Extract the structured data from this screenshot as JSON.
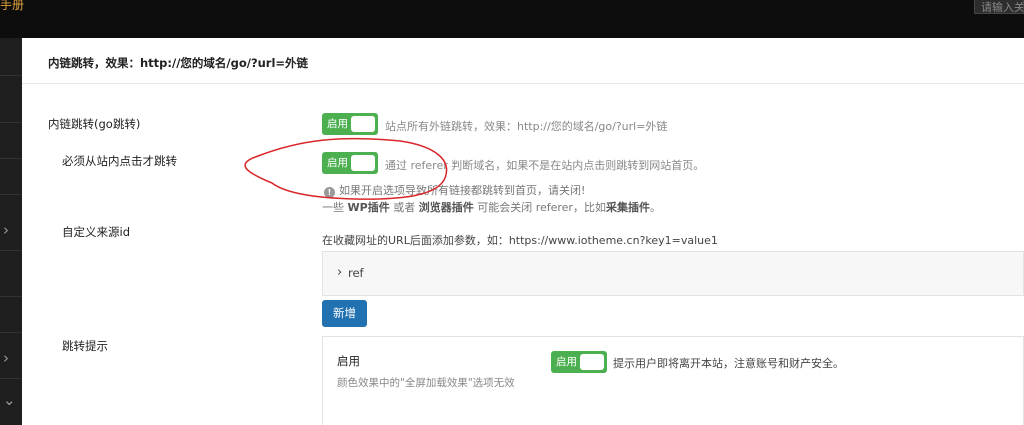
{
  "topbar": {
    "brand": "手册",
    "search_placeholder": "请输入关"
  },
  "panel": {
    "title": "内链跳转，效果：http://您的域名/go/?url=外链"
  },
  "fields": {
    "go_jump": {
      "label": "内链跳转(go跳转)",
      "toggle": "启用",
      "description": "站点所有外链跳转，效果：http://您的域名/go/?url=外链"
    },
    "must_click": {
      "label": "必须从站内点击才跳转",
      "toggle": "启用",
      "description": "通过 referer 判断域名，如果不是在站内点击则跳转到网站首页。",
      "warning": "如果开启选项导致所有链接都跳转到首页，请关闭!",
      "note_prefix": "一些",
      "note_b1": "WP插件",
      "note_mid": "或者",
      "note_b2": "浏览器插件",
      "note_mid2": "可能会关闭 referer，比如",
      "note_b3": "采集插件",
      "note_suffix": "。"
    },
    "custom_source": {
      "label": "自定义来源id",
      "description": "在收藏网址的URL后面添加参数，如：https://www.iotheme.cn?key1=value1",
      "item_label": "ref",
      "add_button": "新增"
    },
    "jump_tip": {
      "label": "跳转提示",
      "enable_label": "启用",
      "enable_hint": "颜色效果中的\"全屏加载效果\"选项无效",
      "toggle": "启用",
      "description": "提示用户即将离开本站，注意账号和财产安全。"
    }
  },
  "icons": {
    "info": "info-icon",
    "chevron_right": "chevron-right-icon",
    "chevron_down": "chevron-down-icon"
  },
  "colors": {
    "toggle_on": "#4caf50",
    "button_primary": "#2271b1",
    "annotation": "#d9262a"
  }
}
